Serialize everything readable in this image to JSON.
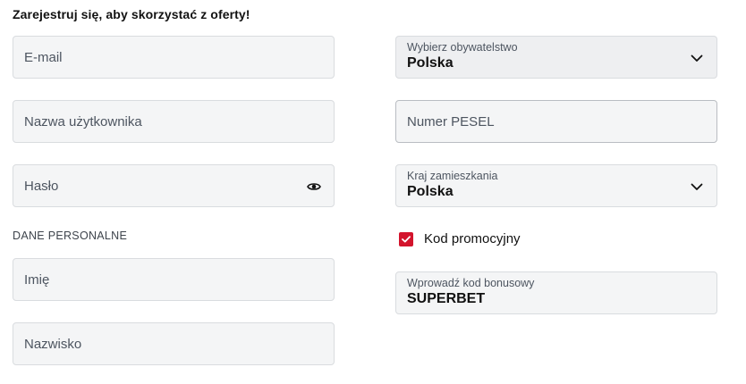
{
  "form": {
    "heading": "Zarejestruj się, aby skorzystać z oferty!",
    "section_personal": "DANE PERSONALNE",
    "email": {
      "placeholder": "E-mail"
    },
    "username": {
      "placeholder": "Nazwa użytkownika"
    },
    "password": {
      "placeholder": "Hasło",
      "icon": "eye-icon"
    },
    "first_name": {
      "placeholder": "Imię"
    },
    "last_name": {
      "placeholder": "Nazwisko"
    },
    "citizenship": {
      "label": "Wybierz obywatelstwo",
      "value": "Polska",
      "icon": "chevron-down-icon"
    },
    "pesel": {
      "placeholder": "Numer PESEL"
    },
    "residence": {
      "label": "Kraj zamieszkania",
      "value": "Polska",
      "icon": "chevron-down-icon"
    },
    "promo": {
      "label": "Kod promocyjny",
      "checked": true,
      "icon": "checkmark-icon"
    },
    "bonus_code": {
      "label": "Wprowadź kod bonusowy",
      "value": "SUPERBET"
    }
  },
  "colors": {
    "accent": "#d3142c",
    "field_bg": "#f4f5f6",
    "field_border": "#d9dcdf",
    "text": "#111111",
    "muted_text": "#4d5560"
  }
}
